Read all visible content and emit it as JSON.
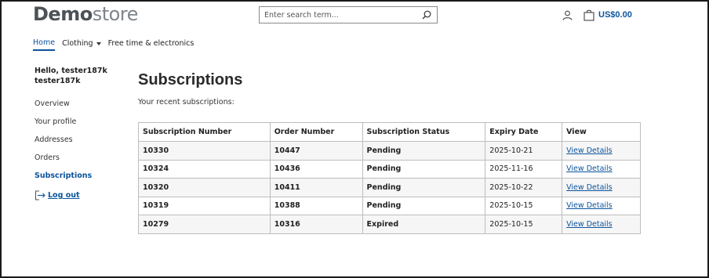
{
  "header": {
    "logo_bold": "Demo",
    "logo_light": "store",
    "search_placeholder": "Enter search term...",
    "cart_total": "US$0.00"
  },
  "nav": {
    "home": "Home",
    "clothing": "Clothing",
    "free_time": "Free time & electronics"
  },
  "sidebar": {
    "greeting_line1": "Hello, tester187k",
    "greeting_line2": "tester187k",
    "items": [
      "Overview",
      "Your profile",
      "Addresses",
      "Orders",
      "Subscriptions"
    ],
    "logout": "Log out"
  },
  "main": {
    "title": "Subscriptions",
    "intro": "Your recent subscriptions:",
    "columns": [
      "Subscription Number",
      "Order Number",
      "Subscription Status",
      "Expiry Date",
      "View"
    ],
    "rows": [
      {
        "sub": "10330",
        "order": "10447",
        "status": "Pending",
        "expiry": "2025-10-21",
        "view": "View Details"
      },
      {
        "sub": "10324",
        "order": "10436",
        "status": "Pending",
        "expiry": "2025-11-16",
        "view": "View Details"
      },
      {
        "sub": "10320",
        "order": "10411",
        "status": "Pending",
        "expiry": "2025-10-22",
        "view": "View Details"
      },
      {
        "sub": "10319",
        "order": "10388",
        "status": "Pending",
        "expiry": "2025-10-15",
        "view": "View Details"
      },
      {
        "sub": "10279",
        "order": "10316",
        "status": "Expired",
        "expiry": "2025-10-15",
        "view": "View Details"
      }
    ]
  },
  "colors": {
    "accent": "#0b539c",
    "logo_bold": "#4c5257",
    "logo_light": "#7f858a"
  },
  "icons": [
    "search-icon",
    "account-icon",
    "cart-icon",
    "logout-icon",
    "chevron-down-icon"
  ]
}
